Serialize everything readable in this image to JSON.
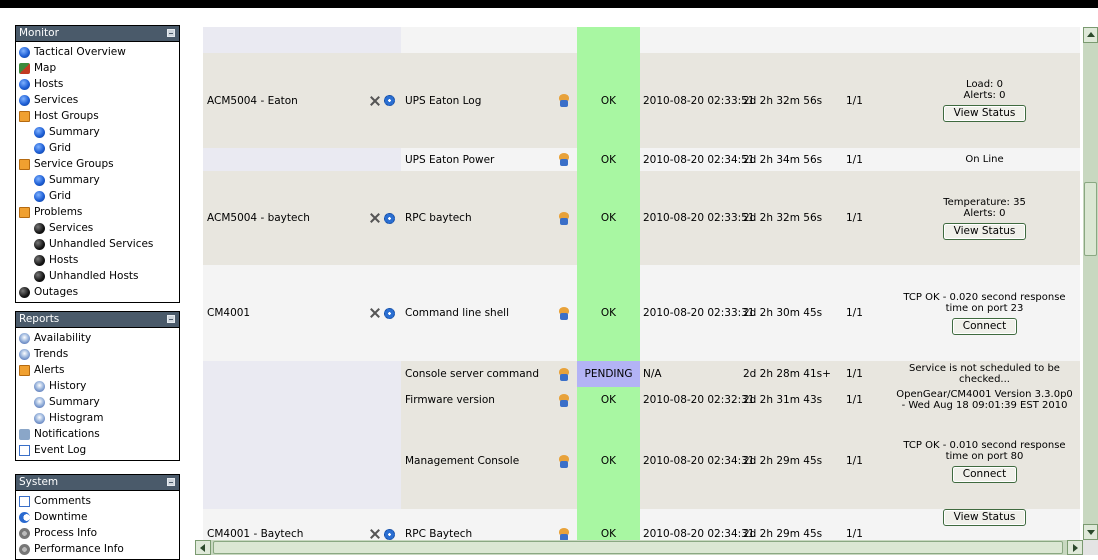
{
  "nav": {
    "monitor": {
      "title": "Monitor",
      "items": [
        {
          "label": "Tactical Overview",
          "icon": "tactical-icon"
        },
        {
          "label": "Map",
          "icon": "map-icon"
        },
        {
          "label": "Hosts",
          "icon": "hosts-icon"
        },
        {
          "label": "Services",
          "icon": "services-icon"
        },
        {
          "label": "Host Groups",
          "icon": "folder-icon"
        },
        {
          "label": "Summary",
          "icon": "summary-icon"
        },
        {
          "label": "Grid",
          "icon": "grid-icon"
        },
        {
          "label": "Service Groups",
          "icon": "folder-icon"
        },
        {
          "label": "Summary",
          "icon": "summary-icon"
        },
        {
          "label": "Grid",
          "icon": "grid-icon"
        },
        {
          "label": "Problems",
          "icon": "folder-icon"
        },
        {
          "label": "Services",
          "icon": "bomb-icon"
        },
        {
          "label": "Unhandled Services",
          "icon": "bomb-icon"
        },
        {
          "label": "Hosts",
          "icon": "bomb-icon"
        },
        {
          "label": "Unhandled Hosts",
          "icon": "bomb-icon"
        },
        {
          "label": "Outages",
          "icon": "bomb-icon"
        }
      ]
    },
    "reports": {
      "title": "Reports",
      "items": [
        {
          "label": "Availability",
          "icon": "helm-icon"
        },
        {
          "label": "Trends",
          "icon": "helm-icon"
        },
        {
          "label": "Alerts",
          "icon": "folder-icon"
        },
        {
          "label": "History",
          "icon": "helm-icon"
        },
        {
          "label": "Summary",
          "icon": "helm-icon"
        },
        {
          "label": "Histogram",
          "icon": "helm-icon"
        },
        {
          "label": "Notifications",
          "icon": "speaker-icon"
        },
        {
          "label": "Event Log",
          "icon": "note-icon"
        }
      ]
    },
    "system": {
      "title": "System",
      "items": [
        {
          "label": "Comments",
          "icon": "note-icon"
        },
        {
          "label": "Downtime",
          "icon": "moon-icon"
        },
        {
          "label": "Process Info",
          "icon": "gear-icon"
        },
        {
          "label": "Performance Info",
          "icon": "gear-icon"
        }
      ]
    }
  },
  "table": {
    "rows": [
      {
        "host": "",
        "service": "",
        "status": "",
        "last_check": "",
        "duration": "",
        "attempt": "",
        "info": [],
        "button": ""
      },
      {
        "host": "ACM5004 - Eaton",
        "service": "UPS Eaton Log",
        "status": "OK",
        "last_check": "2010-08-20 02:33:51",
        "duration": "2d 2h 32m 56s",
        "attempt": "1/1",
        "info": [
          "Load: 0",
          "Alerts: 0"
        ],
        "button": "View Status"
      },
      {
        "host": "",
        "service": "UPS Eaton Power",
        "status": "OK",
        "last_check": "2010-08-20 02:34:51",
        "duration": "2d 2h 34m 56s",
        "attempt": "1/1",
        "info": [
          "On Line"
        ],
        "button": ""
      },
      {
        "host": "ACM5004 - baytech",
        "service": "RPC baytech",
        "status": "OK",
        "last_check": "2010-08-20 02:33:51",
        "duration": "2d 2h 32m 56s",
        "attempt": "1/1",
        "info": [
          "Temperature: 35",
          "Alerts: 0"
        ],
        "button": "View Status"
      },
      {
        "host": "CM4001",
        "service": "Command line shell",
        "status": "OK",
        "last_check": "2010-08-20 02:33:31",
        "duration": "2d 2h 30m 45s",
        "attempt": "1/1",
        "info": [
          "TCP OK - 0.020 second response time on port 23"
        ],
        "button": "Connect"
      },
      {
        "host": "",
        "service": "Console server command",
        "status": "PENDING",
        "last_check": "N/A",
        "duration": "2d 2h 28m 41s+",
        "attempt": "1/1",
        "info": [
          "Service is not scheduled to be checked..."
        ],
        "button": ""
      },
      {
        "host": "",
        "service": "Firmware version",
        "status": "OK",
        "last_check": "2010-08-20 02:32:31",
        "duration": "2d 2h 31m 43s",
        "attempt": "1/1",
        "info": [
          "OpenGear/CM4001 Version 3.3.0p0 - Wed Aug 18 09:01:39 EST 2010"
        ],
        "button": ""
      },
      {
        "host": "",
        "service": "Management Console",
        "status": "OK",
        "last_check": "2010-08-20 02:34:31",
        "duration": "2d 2h 29m 45s",
        "attempt": "1/1",
        "info": [
          "TCP OK - 0.010 second response time on port 80"
        ],
        "button": "Connect"
      },
      {
        "host": "CM4001 - Baytech",
        "service": "RPC Baytech",
        "status": "OK",
        "last_check": "2010-08-20 02:34:31",
        "duration": "2d 2h 29m 45s",
        "attempt": "1/1",
        "info": [],
        "button": "View Status"
      }
    ]
  },
  "colors": {
    "status_ok": "#a8f7a2",
    "status_pending": "#b3b3f5",
    "row_alt": "#e8e6df",
    "panel_header": "#4a5a6a"
  }
}
